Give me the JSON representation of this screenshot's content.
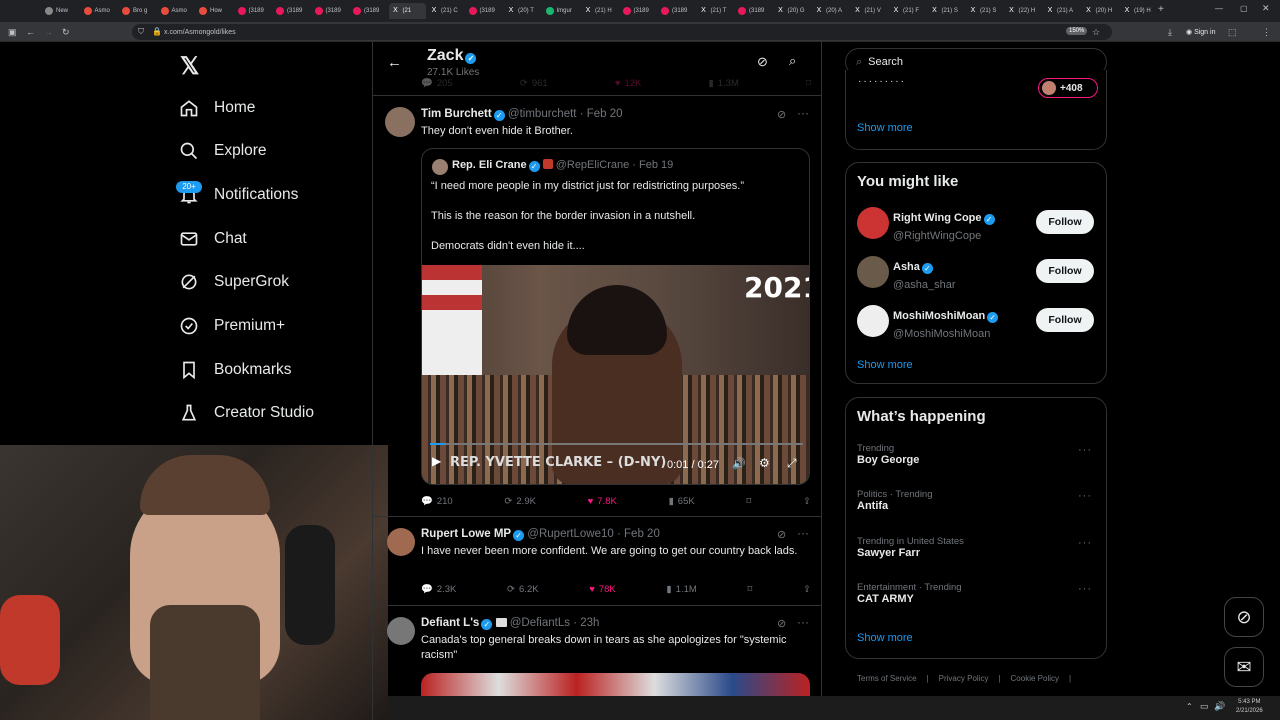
{
  "browser": {
    "tabs": [
      {
        "label": "New"
      },
      {
        "label": "Asmo"
      },
      {
        "label": "Bro g"
      },
      {
        "label": "Asmo"
      },
      {
        "label": "How"
      },
      {
        "label": "(3189"
      },
      {
        "label": "(3189"
      },
      {
        "label": "(3189"
      },
      {
        "label": "(3189"
      },
      {
        "label": "(21"
      },
      {
        "label": "(21) C"
      },
      {
        "label": "(3189"
      },
      {
        "label": "(20) T"
      },
      {
        "label": "Imgur"
      },
      {
        "label": "(21) H"
      },
      {
        "label": "(3189"
      },
      {
        "label": "(3189"
      },
      {
        "label": "(21) T"
      },
      {
        "label": "(3189"
      },
      {
        "label": "(20) G"
      },
      {
        "label": "(20) A"
      },
      {
        "label": "(21) V"
      },
      {
        "label": "(21) F"
      },
      {
        "label": "(21) S"
      },
      {
        "label": "(21) S"
      },
      {
        "label": "(22) H"
      },
      {
        "label": "(21) A"
      },
      {
        "label": "(20) H"
      },
      {
        "label": "(19) H"
      }
    ],
    "url": "x.com/Asmongold/likes",
    "zoom": "150%",
    "signin": "Sign in"
  },
  "nav": {
    "items": [
      {
        "label": "Home"
      },
      {
        "label": "Explore"
      },
      {
        "label": "Notifications"
      },
      {
        "label": "Chat"
      },
      {
        "label": "SuperGrok"
      },
      {
        "label": "Premium+"
      },
      {
        "label": "Bookmarks"
      },
      {
        "label": "Creator Studio"
      }
    ],
    "notif_badge": "20+"
  },
  "header": {
    "title": "Zack",
    "subtitle": "27.1K Likes",
    "prev_stats": {
      "replies": "205",
      "reposts": "961",
      "likes": "12K",
      "views": "1.3M"
    }
  },
  "tweets": [
    {
      "name": "Tim Burchett",
      "handle": "@timburchett",
      "date": "Feb 20",
      "text": "They don't even hide it Brother.",
      "quote": {
        "name": "Rep. Eli Crane",
        "handle": "@RepEliCrane",
        "date": "Feb 19",
        "line1": "“I need more people in my district just for redistricting purposes.”",
        "line2": "This is the reason for the border invasion in a nutshell.",
        "line3": "Democrats didn't even hide it....",
        "video_year": "2021",
        "video_caption": "REP. YVETTE CLARKE – (D-NY)",
        "video_time": "0:01 / 0:27"
      },
      "stats": {
        "replies": "210",
        "reposts": "2.9K",
        "likes": "7.8K",
        "views": "65K"
      }
    },
    {
      "name": "Rupert Lowe MP",
      "handle": "@RupertLowe10",
      "date": "Feb 20",
      "text": "I have never been more confident. We are going to get our country back lads.",
      "stats": {
        "replies": "2.3K",
        "reposts": "6.2K",
        "likes": "78K",
        "views": "1.1M"
      }
    },
    {
      "name": "Defiant L's",
      "handle": "@DefiantLs",
      "date": "23h",
      "text": "Canada's top general breaks down in tears as she apologizes for \"systemic racism\""
    }
  ],
  "search": {
    "placeholder": "Search"
  },
  "top_card": {
    "count": "+408",
    "show_more": "Show more"
  },
  "you_might_like": {
    "title": "You might like",
    "users": [
      {
        "name": "Right Wing Cope",
        "handle": "@RightWingCope",
        "button": "Follow"
      },
      {
        "name": "Asha",
        "handle": "@asha_shar",
        "button": "Follow"
      },
      {
        "name": "MoshiMoshiMoan",
        "handle": "@MoshiMoshiMoan",
        "button": "Follow"
      }
    ],
    "show_more": "Show more"
  },
  "happening": {
    "title": "What’s happening",
    "trends": [
      {
        "category": "Trending",
        "name": "Boy George"
      },
      {
        "category": "Politics · Trending",
        "name": "Antifa"
      },
      {
        "category": "Trending in United States",
        "name": "Sawyer Farr"
      },
      {
        "category": "Entertainment · Trending",
        "name": "CAT ARMY"
      }
    ],
    "show_more": "Show more"
  },
  "footer": {
    "links": [
      "Terms of Service",
      "Privacy Policy",
      "Cookie Policy"
    ]
  },
  "taskbar": {
    "time": "5:43 PM",
    "date": "2/21/2026"
  },
  "colors": {
    "accent": "#1d9bf0",
    "like": "#f91880",
    "border": "#2f3336",
    "muted": "#71767b"
  }
}
